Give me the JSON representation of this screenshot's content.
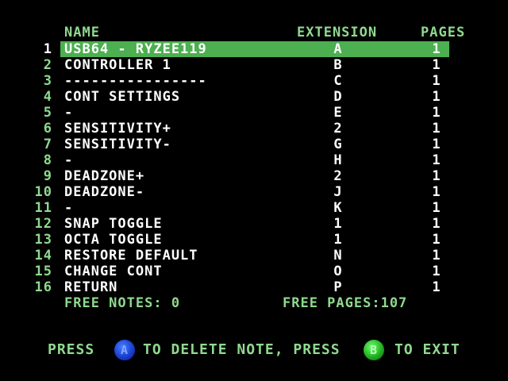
{
  "headers": {
    "name": "NAME",
    "extension": "EXTENSION",
    "pages": "PAGES"
  },
  "notes": [
    {
      "num": "1",
      "name": "USB64 - RYZEE119",
      "ext": "A",
      "pages": "1"
    },
    {
      "num": "2",
      "name": "CONTROLLER 1",
      "ext": "B",
      "pages": "1"
    },
    {
      "num": "3",
      "name": "----------------",
      "ext": "C",
      "pages": "1"
    },
    {
      "num": "4",
      "name": "CONT SETTINGS",
      "ext": "D",
      "pages": "1"
    },
    {
      "num": "5",
      "name": "-",
      "ext": "E",
      "pages": "1"
    },
    {
      "num": "6",
      "name": "SENSITIVITY+",
      "ext": "2",
      "pages": "1"
    },
    {
      "num": "7",
      "name": "SENSITIVITY-",
      "ext": "G",
      "pages": "1"
    },
    {
      "num": "8",
      "name": "-",
      "ext": "H",
      "pages": "1"
    },
    {
      "num": "9",
      "name": "DEADZONE+",
      "ext": "2",
      "pages": "1"
    },
    {
      "num": "10",
      "name": "DEADZONE-",
      "ext": "J",
      "pages": "1"
    },
    {
      "num": "11",
      "name": "-",
      "ext": "K",
      "pages": "1"
    },
    {
      "num": "12",
      "name": "SNAP TOGGLE",
      "ext": "1",
      "pages": "1"
    },
    {
      "num": "13",
      "name": "OCTA TOGGLE",
      "ext": "1",
      "pages": "1"
    },
    {
      "num": "14",
      "name": "RESTORE DEFAULT",
      "ext": "N",
      "pages": "1"
    },
    {
      "num": "15",
      "name": "CHANGE CONT",
      "ext": "O",
      "pages": "1"
    },
    {
      "num": "16",
      "name": "RETURN",
      "ext": "P",
      "pages": "1"
    }
  ],
  "selected_index": 0,
  "free": {
    "notes": "FREE NOTES: 0",
    "pages": "FREE PAGES:107"
  },
  "footer": {
    "press1": "PRESS",
    "button_a": "A",
    "to_delete": "TO DELETE NOTE, PRESS",
    "button_b": "B",
    "to_exit": "TO EXIT"
  },
  "colors": {
    "background": "#000000",
    "accent_green": "#8fd98f",
    "selection_bar": "#4caf50",
    "button_a": "#1a3fd0",
    "button_b": "#22b022"
  }
}
